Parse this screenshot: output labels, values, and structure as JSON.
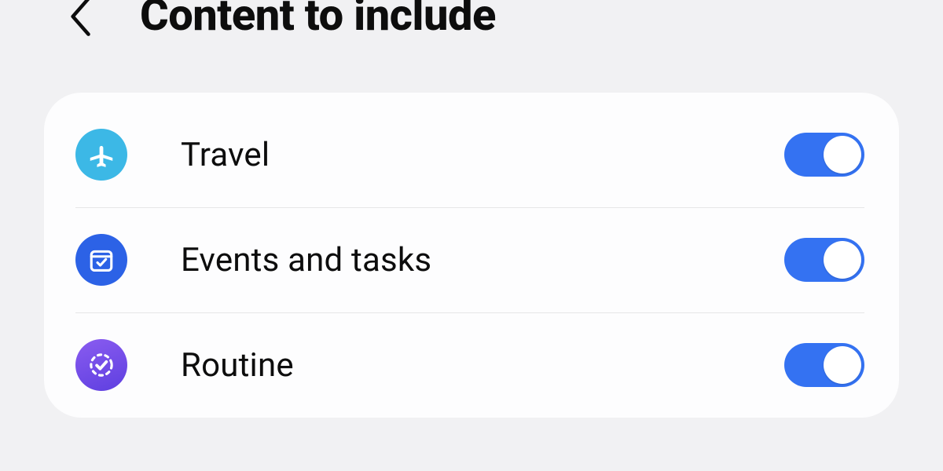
{
  "header": {
    "title": "Content to include"
  },
  "items": [
    {
      "icon": "airplane",
      "label": "Travel",
      "enabled": true,
      "badge_color": "#3cb8e6"
    },
    {
      "icon": "calendar-check",
      "label": "Events and tasks",
      "enabled": true,
      "badge_color": "#2c62e6"
    },
    {
      "icon": "routine-check",
      "label": "Routine",
      "enabled": true,
      "badge_color": "#6b44e6"
    }
  ],
  "colors": {
    "page_bg": "#f1f1f3",
    "card_bg": "#fdfdfe",
    "text": "#0d0d0d",
    "divider": "#e6e6e8",
    "switch_on": "#3472f2"
  }
}
